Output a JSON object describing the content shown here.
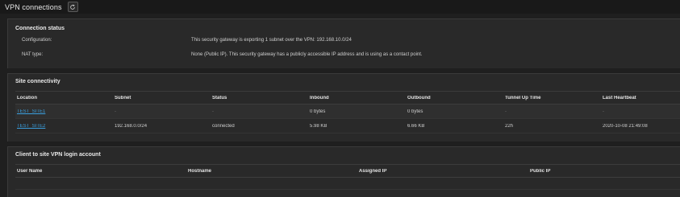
{
  "header": {
    "title": "VPN connections",
    "refresh_icon": "refresh-icon"
  },
  "connection_status": {
    "title": "Connection status",
    "rows": [
      {
        "key": "Configuration:",
        "value": "This security gateway is exporting 1 subnet over the VPN: 192.168.10.0/24"
      },
      {
        "key": "NAT type:",
        "value": "None (Public IP). This security gateway has a publicly accessible IP address and is using  as a contact point."
      }
    ]
  },
  "site_connectivity": {
    "title": "Site connectivity",
    "columns": [
      "Location",
      "Subnet",
      "Status",
      "Inbound",
      "Outbound",
      "Tunnel Up Time",
      "Last Heartbeat"
    ],
    "rows": [
      {
        "location": "TEST_SITE1",
        "subnet": "-",
        "status": "-",
        "inbound": "0 bytes",
        "outbound": "0 bytes",
        "uptime": "-",
        "heartbeat": "-"
      },
      {
        "location": "TEST_SITE2",
        "subnet": "192.168.0.0/24",
        "status": "connected",
        "inbound": "5.98 KB",
        "outbound": "6.66 KB",
        "uptime": "22h",
        "heartbeat": "2020-10-08 21:49:08"
      }
    ]
  },
  "client_vpn": {
    "title": "Client to site VPN login account",
    "columns": [
      "User Name",
      "Hostname",
      "Assigned IP",
      "Public IP"
    ]
  },
  "colors": {
    "background": "#1f1f1f",
    "panel": "#292929",
    "link": "#3aa0e0"
  }
}
